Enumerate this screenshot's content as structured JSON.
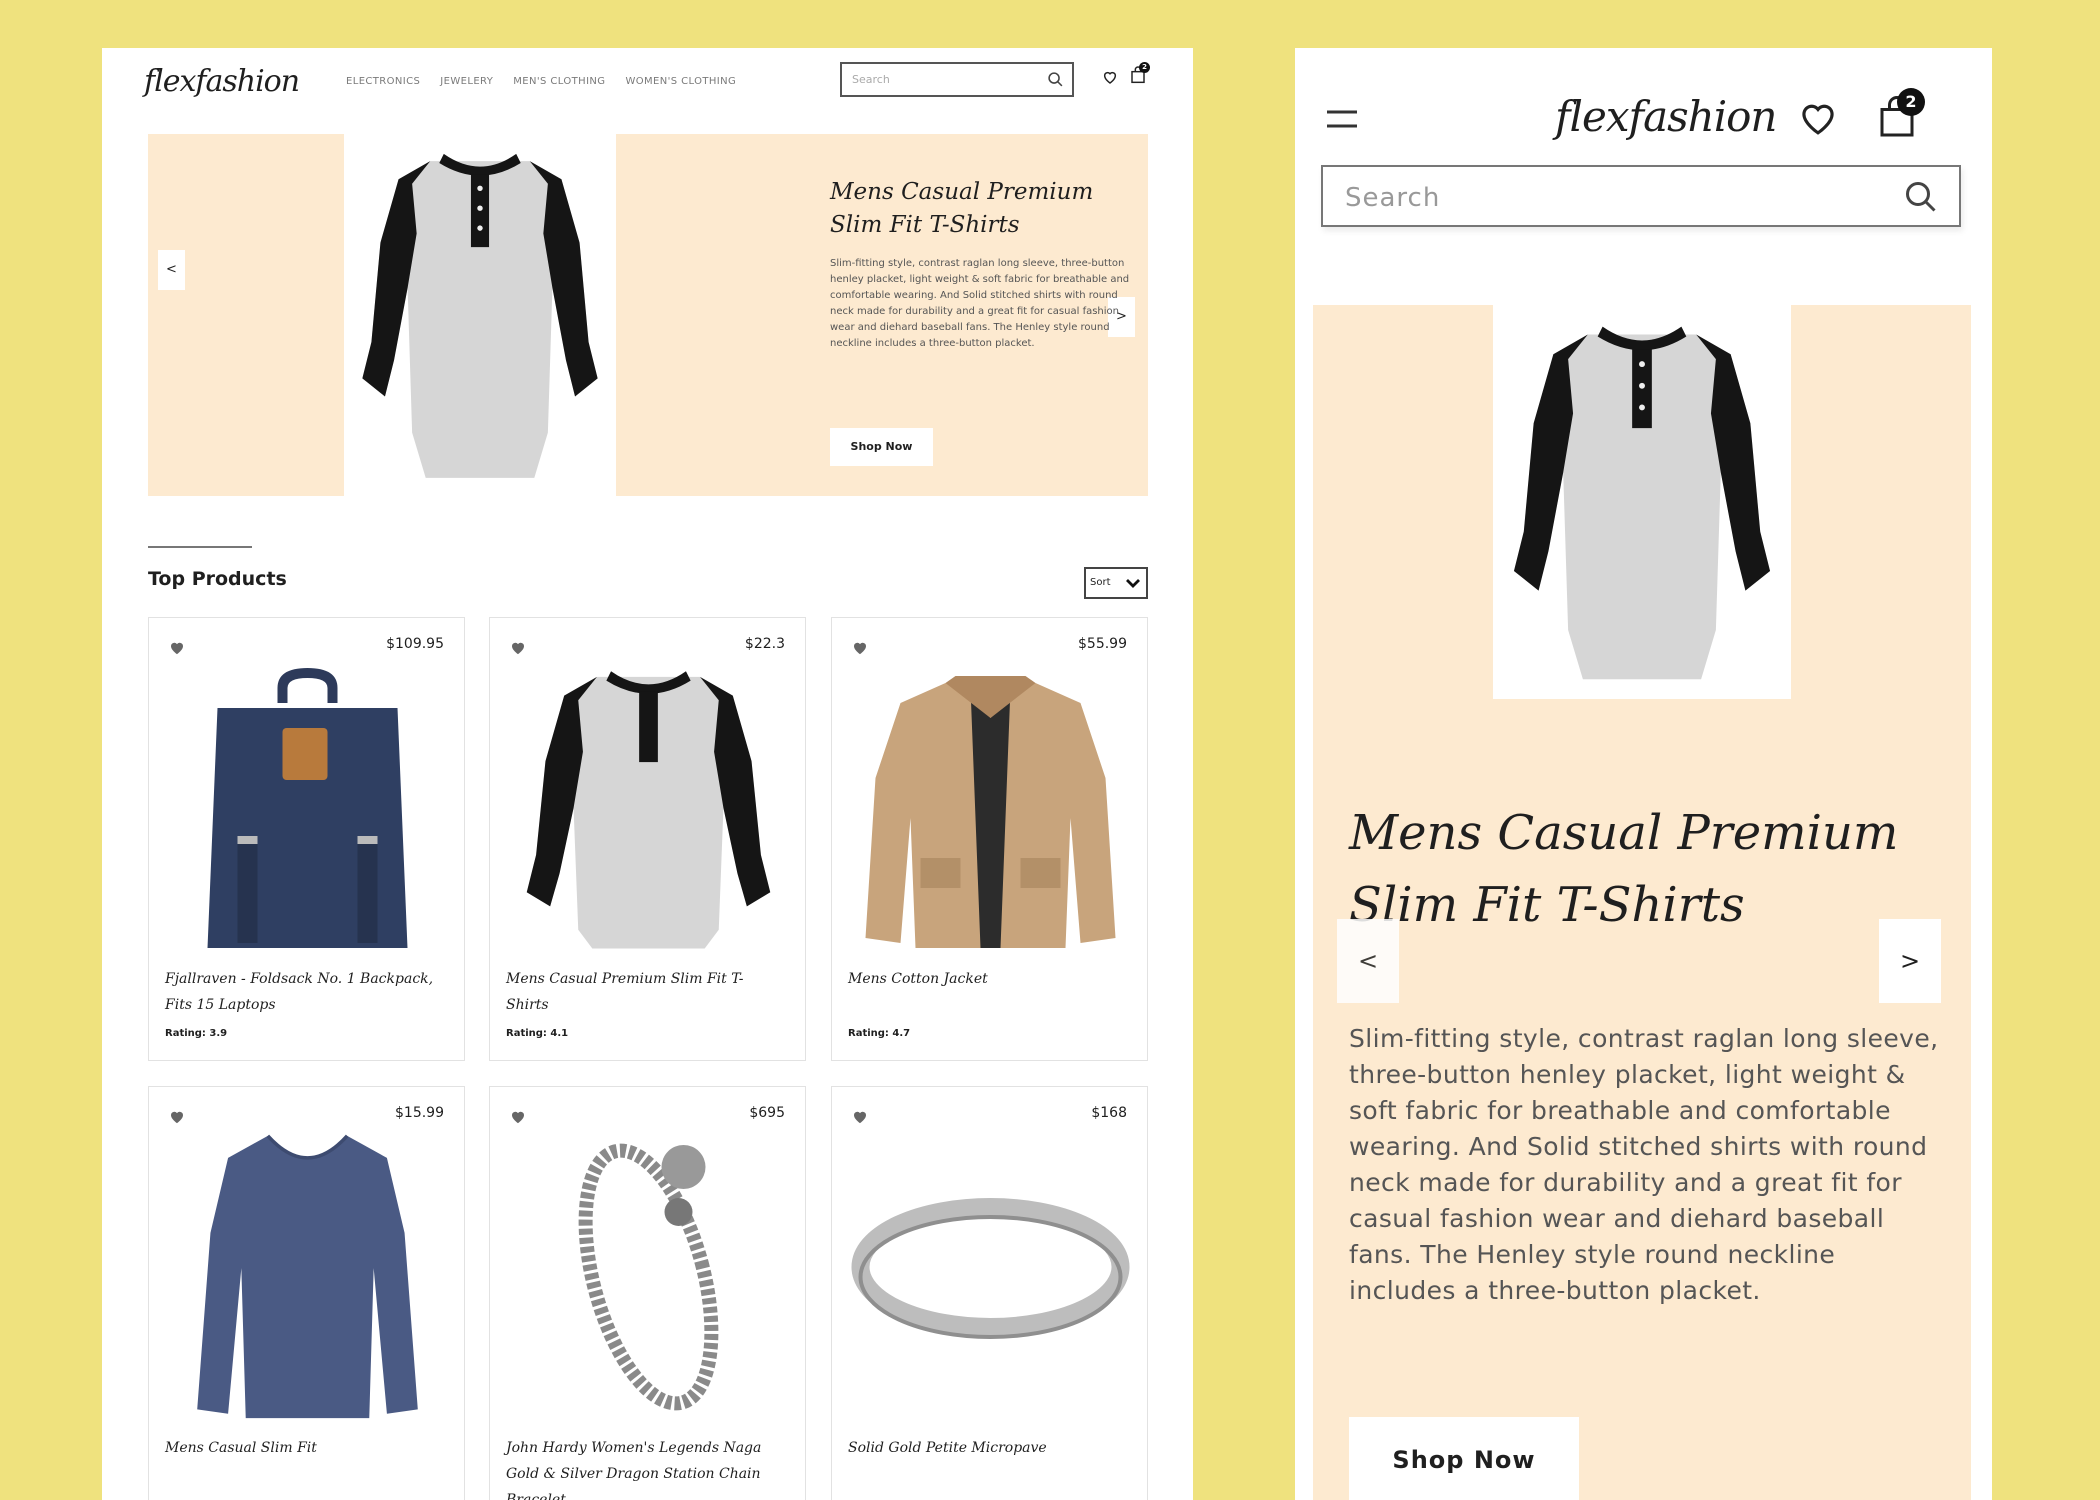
{
  "brand": "flexfashion",
  "nav": [
    "ELECTRONICS",
    "JEWELERY",
    "MEN'S CLOTHING",
    "WOMEN'S CLOTHING"
  ],
  "search_placeholder": "Search",
  "cart_count": "2",
  "hero": {
    "title": "Mens Casual Premium Slim Fit T-Shirts",
    "description": "Slim-fitting style, contrast raglan long sleeve, three-button henley placket, light weight & soft fabric for breathable and comfortable wearing. And Solid stitched shirts with round neck made for durability and a great fit for casual fashion wear and diehard baseball fans. The Henley style round neckline includes a three-button placket.",
    "cta": "Shop Now",
    "prev": "<",
    "next": ">"
  },
  "section": {
    "title": "Top Products",
    "sort_label": "Sort"
  },
  "products": [
    {
      "name": "Fjallraven - Foldsack No. 1 Backpack, Fits 15 Laptops",
      "price": "$109.95",
      "rating": "Rating: 3.9"
    },
    {
      "name": "Mens Casual Premium Slim Fit T-Shirts",
      "price": "$22.3",
      "rating": "Rating: 4.1"
    },
    {
      "name": "Mens Cotton Jacket",
      "price": "$55.99",
      "rating": "Rating: 4.7"
    },
    {
      "name": "Mens Casual Slim Fit",
      "price": "$15.99",
      "rating": ""
    },
    {
      "name": "John Hardy Women's Legends Naga Gold & Silver Dragon Station Chain Bracelet",
      "price": "$695",
      "rating": ""
    },
    {
      "name": "Solid Gold Petite Micropave",
      "price": "$168",
      "rating": ""
    }
  ],
  "colors": {
    "background": "#efe27e",
    "hero_bg": "#fdead0",
    "text": "#1f1f1f"
  },
  "icons": [
    "search-icon",
    "heart-icon",
    "cart-icon",
    "menu-icon",
    "chevron-down-icon"
  ]
}
